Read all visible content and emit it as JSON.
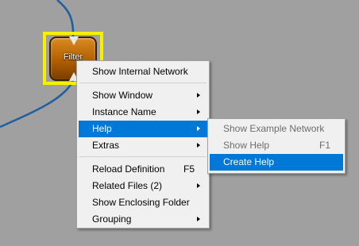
{
  "node": {
    "label": "Filter"
  },
  "context_menu": {
    "items": [
      {
        "label": "Show Internal Network"
      },
      {
        "label": "Show Window"
      },
      {
        "label": "Instance Name"
      },
      {
        "label": "Help"
      },
      {
        "label": "Extras"
      },
      {
        "label": "Reload Definition",
        "shortcut": "F5"
      },
      {
        "label": "Related Files (2)"
      },
      {
        "label": "Show Enclosing Folder"
      },
      {
        "label": "Grouping"
      }
    ]
  },
  "help_submenu": {
    "items": [
      {
        "label": "Show Example Network"
      },
      {
        "label": "Show Help",
        "shortcut": "F1"
      },
      {
        "label": "Create Help"
      }
    ]
  },
  "colors": {
    "canvas": "#a0a0a0",
    "wire": "#1f5f9f",
    "selection": "#f7f000",
    "node": "#b05f00",
    "menu_highlight": "#0078d7"
  }
}
